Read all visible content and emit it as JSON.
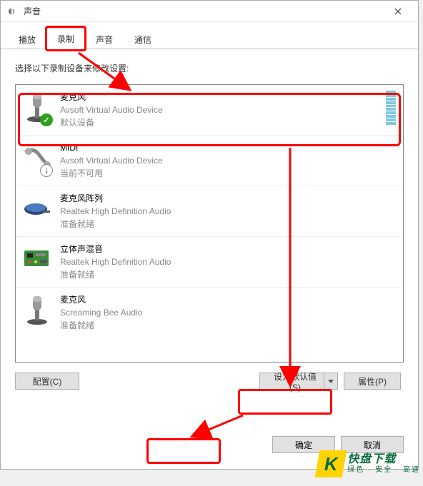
{
  "window": {
    "title": "声音"
  },
  "tabs": {
    "items": [
      {
        "label": "播放"
      },
      {
        "label": "录制"
      },
      {
        "label": "声音"
      },
      {
        "label": "通信"
      }
    ],
    "active_index": 1
  },
  "instruction": "选择以下录制设备来修改设置:",
  "devices": [
    {
      "name": "麦克风",
      "desc": "Avsoft Virtual Audio Device",
      "status": "默认设备",
      "badge": "check",
      "meter": 10
    },
    {
      "name": "MIDI",
      "desc": "Avsoft Virtual Audio Device",
      "status": "当前不可用",
      "badge": "down",
      "meter": 0
    },
    {
      "name": "麦克风阵列",
      "desc": "Realtek High Definition Audio",
      "status": "准备就绪",
      "badge": null,
      "meter": 0
    },
    {
      "name": "立体声混音",
      "desc": "Realtek High Definition Audio",
      "status": "准备就绪",
      "badge": null,
      "meter": 0
    },
    {
      "name": "麦克风",
      "desc": "Screaming Bee Audio",
      "status": "准备就绪",
      "badge": null,
      "meter": 0
    }
  ],
  "buttons": {
    "config": "配置(C)",
    "set_default": "设为默认值(S)",
    "properties": "属性(P)",
    "ok": "确定",
    "cancel": "取消"
  },
  "watermark": {
    "top": "快盘下载",
    "bottom": "绿色 · 安全 · 高速"
  }
}
